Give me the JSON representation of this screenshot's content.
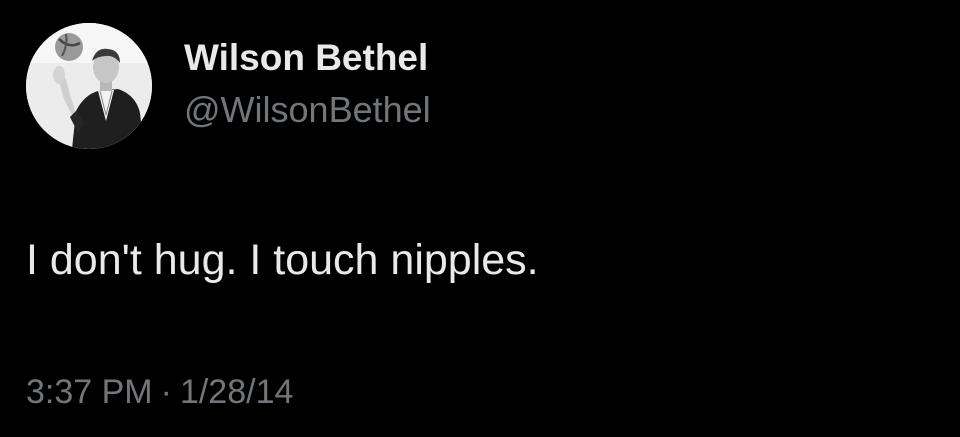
{
  "author": {
    "display_name": "Wilson Bethel",
    "handle": "@WilsonBethel",
    "avatar_icon": "profile-photo"
  },
  "tweet": {
    "text": "I don't hug. I touch nipples.",
    "time": "3:37 PM",
    "separator": "·",
    "date": "1/28/14"
  },
  "colors": {
    "background": "#000000",
    "primary_text": "#e7e9ea",
    "secondary_text": "#71767b"
  }
}
